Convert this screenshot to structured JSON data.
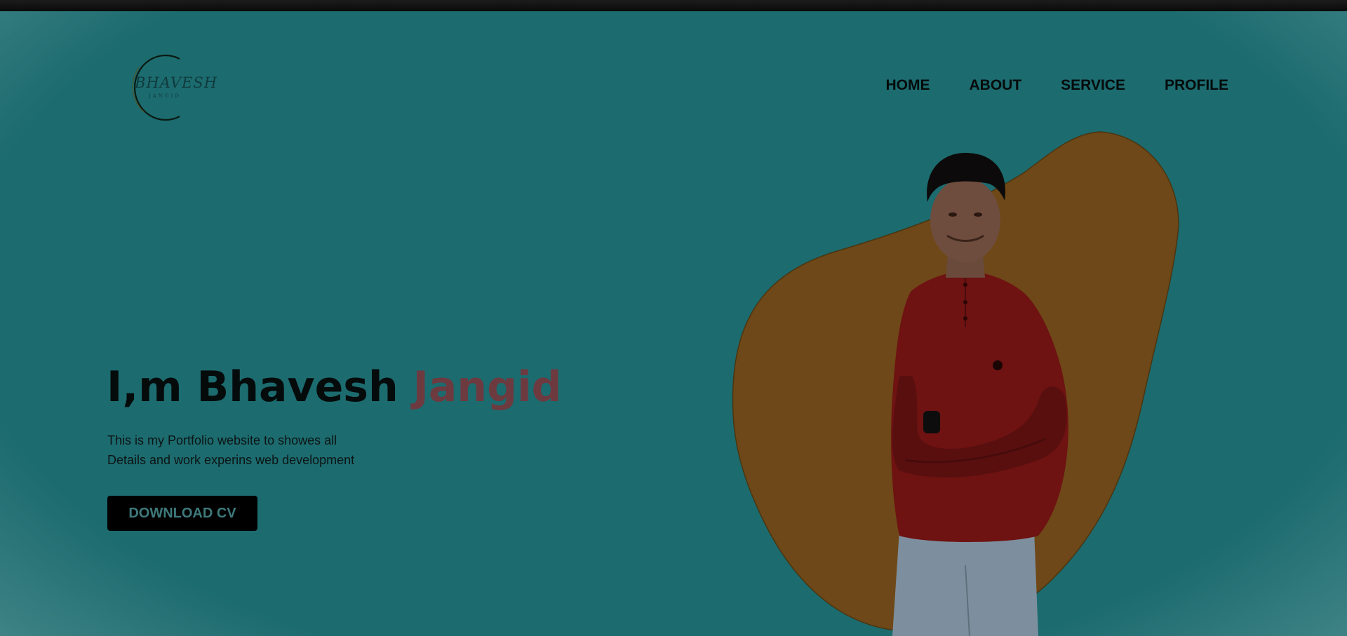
{
  "logo": {
    "main_text": "BHAVESH",
    "sub_text": "JANGID"
  },
  "nav": {
    "items": [
      {
        "label": "HOME"
      },
      {
        "label": "ABOUT"
      },
      {
        "label": "SERVICE"
      },
      {
        "label": "PROFILE"
      }
    ]
  },
  "hero": {
    "title_prefix": "I,m Bhavesh ",
    "title_highlight": "Jangid",
    "description_line1": "This is my Portfolio website to showes all",
    "description_line2": "Details and work experins web development",
    "cta_label": "DOWNLOAD CV"
  },
  "colors": {
    "background": "#1c6b6f",
    "blob": "#6e4818",
    "accent_name": "#6d3a40",
    "button_bg": "#000000",
    "button_text": "#3e7a7c",
    "shirt": "#6e1212",
    "jeans": "#7d8f9e"
  }
}
